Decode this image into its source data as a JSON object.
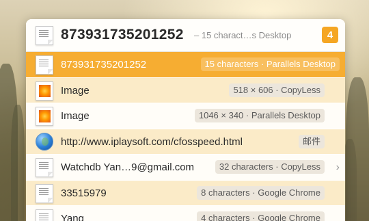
{
  "header": {
    "title": "873931735201252",
    "subtitle": "– 15 charact…s Desktop",
    "count": "4"
  },
  "rows": [
    {
      "label": "873931735201252",
      "meta": "15 characters · Parallels Desktop",
      "icon": "text-document-icon",
      "selected": true
    },
    {
      "label": "Image",
      "meta": "518 × 606 · CopyLess",
      "icon": "image-icon"
    },
    {
      "label": "Image",
      "meta": "1046 × 340 · Parallels Desktop",
      "icon": "image-icon"
    },
    {
      "label": "http://www.iplaysoft.com/cfosspeed.html",
      "meta": "邮件",
      "icon": "globe-icon"
    },
    {
      "label": "Watchdb Yan…9@gmail.com",
      "meta": "32 characters · CopyLess",
      "icon": "text-document-icon",
      "chevron": "›"
    },
    {
      "label": "33515979",
      "meta": "8 characters · Google Chrome",
      "icon": "text-document-icon"
    },
    {
      "label": "Yang",
      "meta": "4 characters · Google Chrome",
      "icon": "text-document-icon"
    }
  ],
  "colors": {
    "accent": "#f6ad32",
    "row_alt": "#fbebc8",
    "badge": "#f5a623"
  }
}
